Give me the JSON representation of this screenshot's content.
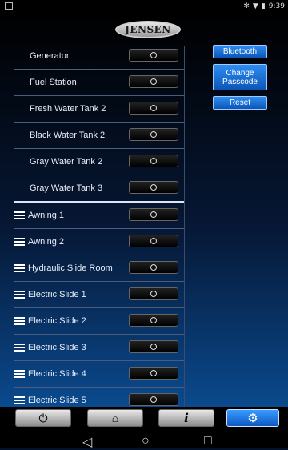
{
  "status": {
    "time": "9:39",
    "bluetooth_icon": "bluetooth-icon",
    "wifi_icon": "wifi-icon",
    "battery_icon": "battery-icon",
    "notification_icon": "image-icon"
  },
  "brand": {
    "logo_text": "JENSEN"
  },
  "devices": [
    {
      "label": "Generator"
    },
    {
      "label": "Fuel Station"
    },
    {
      "label": "Fresh Water Tank 2"
    },
    {
      "label": "Black Water Tank 2"
    },
    {
      "label": "Gray Water Tank 2"
    },
    {
      "label": "Gray Water Tank 3"
    }
  ],
  "controls": [
    {
      "label": "Awning 1"
    },
    {
      "label": "Awning 2"
    },
    {
      "label": "Hydraulic Slide Room"
    },
    {
      "label": "Electric Slide 1"
    },
    {
      "label": "Electric Slide 2"
    },
    {
      "label": "Electric Slide 3"
    },
    {
      "label": "Electric Slide 4"
    },
    {
      "label": "Electric Slide 5"
    }
  ],
  "buttons": {
    "bluetooth": "Bluetooth",
    "change_passcode_line1": "Change",
    "change_passcode_line2": "Passcode",
    "reset": "Reset"
  },
  "nav": {
    "power_icon": "power-icon",
    "home_icon": "home-icon",
    "info_label": "i",
    "settings_icon": "gear-icon",
    "active": "settings"
  },
  "android": {
    "back_icon": "back-icon",
    "home_icon": "circle-home-icon",
    "recent_icon": "recent-apps-icon"
  }
}
